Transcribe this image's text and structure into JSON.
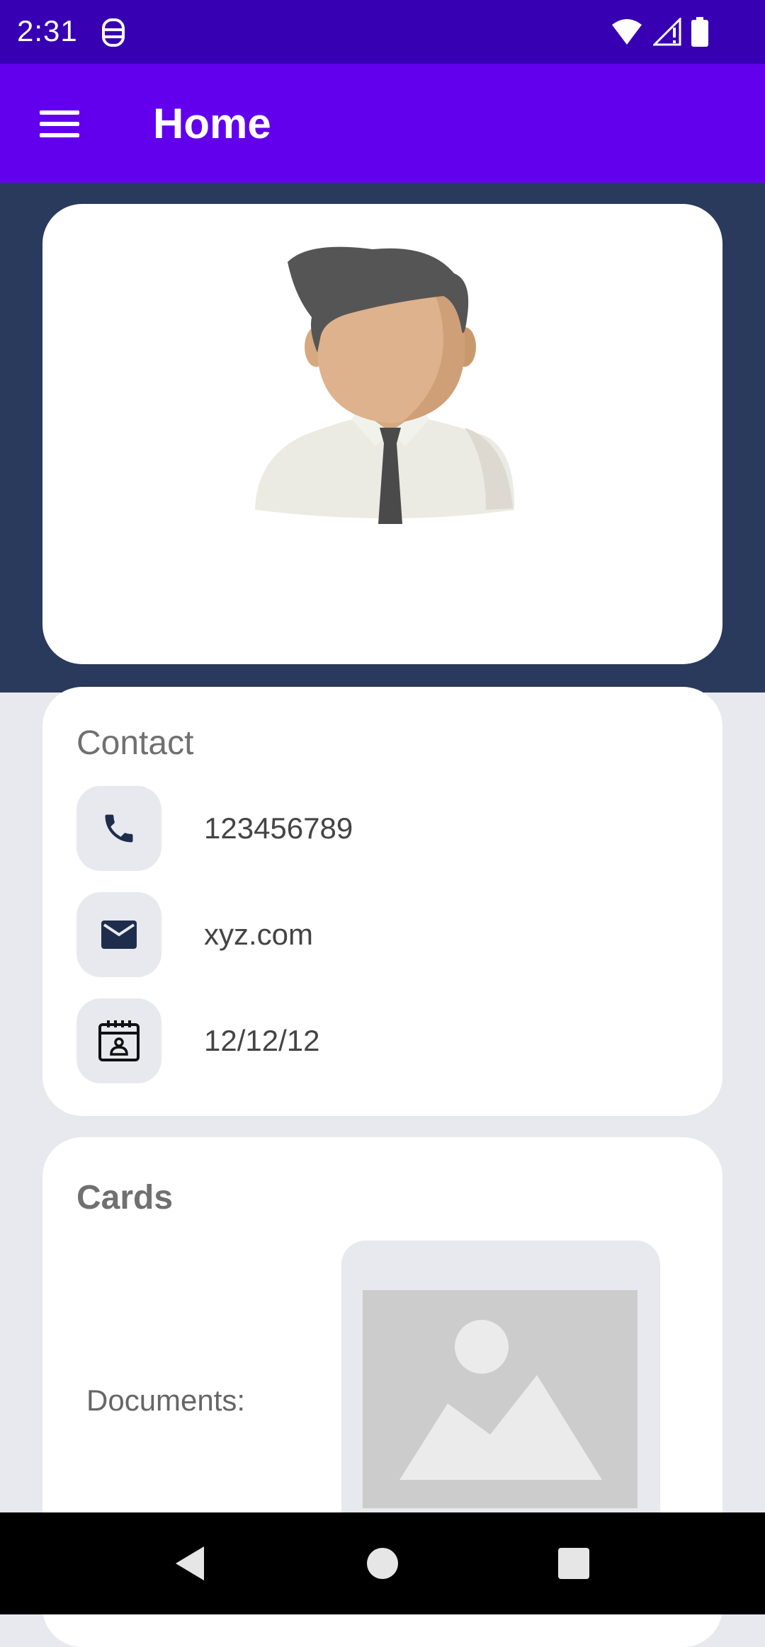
{
  "status_bar": {
    "time": "2:31",
    "icons": [
      "notification-icon",
      "wifi-icon",
      "signal-icon",
      "battery-icon"
    ]
  },
  "app_bar": {
    "title": "Home",
    "menu_icon": "hamburger-menu-icon",
    "background": "#6200ee"
  },
  "profile": {
    "avatar_icon": "person-avatar-icon"
  },
  "contact": {
    "title": "Contact",
    "items": [
      {
        "icon": "phone-icon",
        "value": "123456789"
      },
      {
        "icon": "mail-icon",
        "value": "xyz.com"
      },
      {
        "icon": "calendar-person-icon",
        "value": "12/12/12"
      }
    ]
  },
  "cards": {
    "title": "Cards",
    "documents_label": "Documents:",
    "document_icon": "image-placeholder-icon"
  },
  "nav_bar": {
    "buttons": [
      "back-icon",
      "home-icon",
      "recents-icon"
    ]
  },
  "colors": {
    "status_bar": "#3700b3",
    "app_bar": "#6200ee",
    "hero_background": "#2a3a5c",
    "page_background": "#e8e9ee"
  }
}
